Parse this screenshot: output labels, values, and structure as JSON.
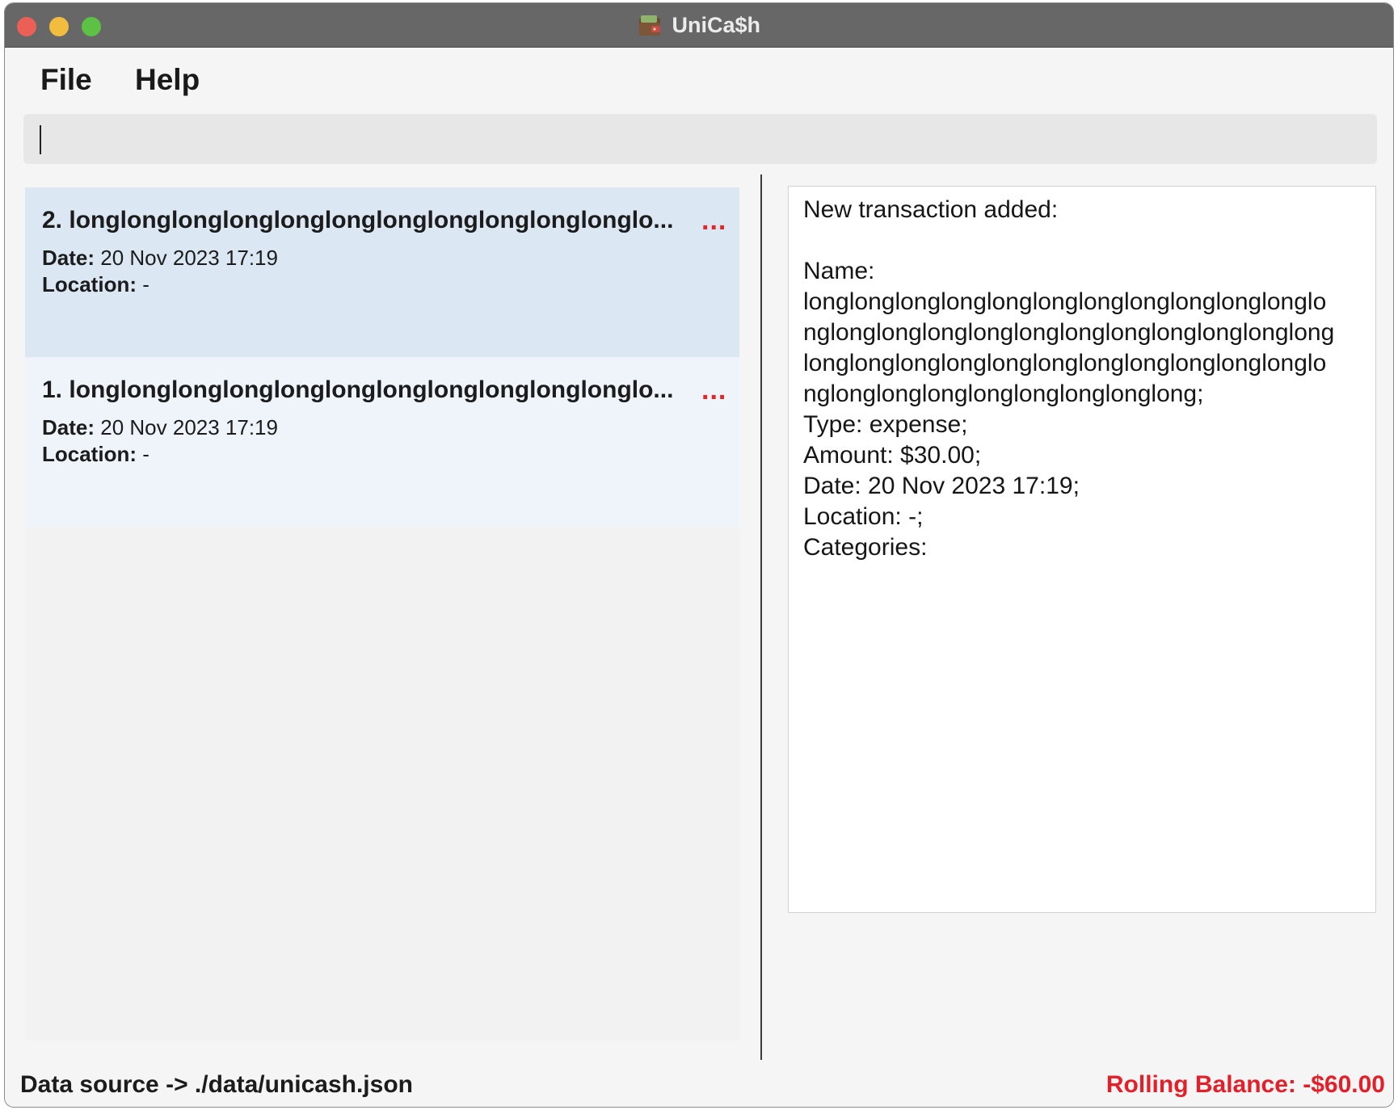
{
  "window": {
    "title": "UniCa$h",
    "app_icon": "wallet-icon"
  },
  "menu": {
    "file_label": "File",
    "help_label": "Help"
  },
  "command_box": {
    "value": ""
  },
  "transactions": [
    {
      "title": "2. longlonglonglonglonglonglonglonglonglonglonglo...",
      "overflow_indicator": "...",
      "date_label": "Date:",
      "date_value": "20 Nov 2023 17:19",
      "location_label": "Location:",
      "location_value": "-"
    },
    {
      "title": "1. longlonglonglonglonglonglonglonglonglonglonglo...",
      "overflow_indicator": "...",
      "date_label": "Date:",
      "date_value": "20 Nov 2023 17:19",
      "location_label": "Location:",
      "location_value": "-"
    }
  ],
  "result": {
    "text": "New transaction added:\n\nName:\nlonglonglonglonglonglonglonglonglonglonglonglo\nnglonglonglonglonglonglonglonglonglonglonglong\nlonglonglonglonglonglonglonglonglonglonglonglo\nnglonglonglonglonglonglonglonglong;\nType: expense;\nAmount: $30.00;\nDate: 20 Nov 2023 17:19;\nLocation: -;\nCategories:"
  },
  "status": {
    "data_source": "Data source -> ./data/unicash.json",
    "rolling_balance": "Rolling Balance: -$60.00"
  },
  "colors": {
    "accent_red": "#e3202a",
    "selected_card": "#dbe8f4",
    "titlebar": "#676767"
  }
}
